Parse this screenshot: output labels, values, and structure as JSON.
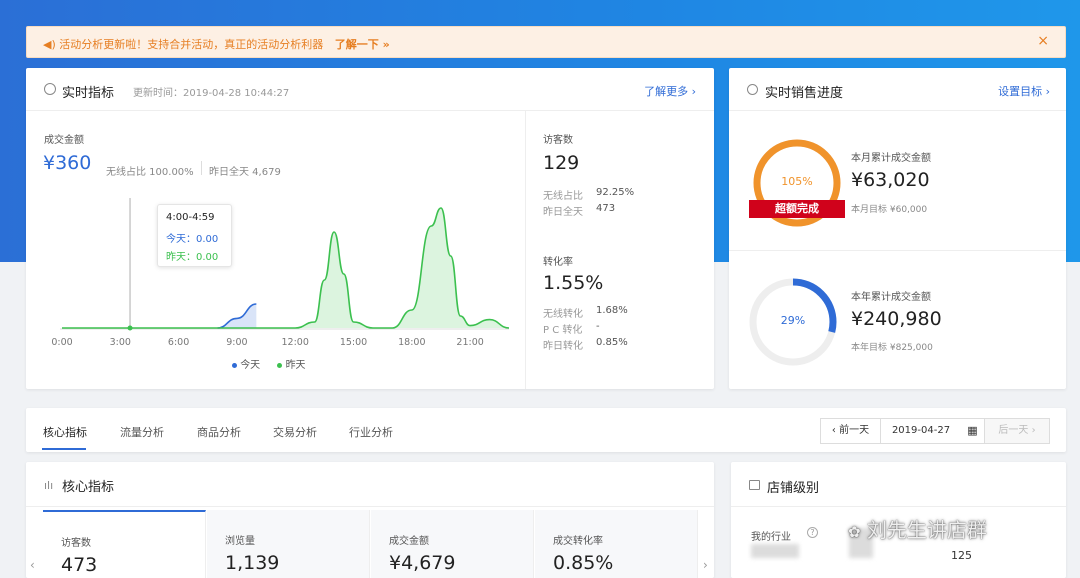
{
  "notice": {
    "text": "活动分析更新啦！支持合并活动，真正的活动分析利器",
    "more": "了解一下 »",
    "close": "×"
  },
  "realtime": {
    "title": "实时指标",
    "update_time": "更新时间：2019-04-28 10:44:27",
    "more": "了解更多 ›",
    "gmv_label": "成交金额",
    "gmv_value": "¥360",
    "wireless_ratio": "无线占比 100.00%",
    "yesterday_total": "昨日全天 4,679",
    "tooltip": {
      "time": "4:00-4:59",
      "today": "今天：0.00",
      "yesterday": "昨天：0.00"
    },
    "legend": {
      "today": "今天",
      "yesterday": "昨天"
    },
    "visitors": {
      "label": "访客数",
      "value": "129",
      "row1_label": "无线占比",
      "row1_value": "92.25%",
      "row2_label": "昨日全天",
      "row2_value": "473"
    },
    "conversion": {
      "label": "转化率",
      "value": "1.55%",
      "row1_label": "无线转化",
      "row1_value": "1.68%",
      "row2_label": "P C 转化",
      "row2_value": "-",
      "row3_label": "昨日转化",
      "row3_value": "0.85%"
    }
  },
  "chart_data": {
    "type": "area",
    "x_ticks": [
      "0:00",
      "3:00",
      "6:00",
      "9:00",
      "12:00",
      "15:00",
      "18:00",
      "21:00"
    ],
    "series": [
      {
        "name": "今天",
        "color": "#2f6bd6",
        "x": [
          8,
          9,
          10
        ],
        "values": [
          0,
          0.08,
          0.2
        ]
      },
      {
        "name": "昨天",
        "color": "#3cc04f",
        "x": [
          0,
          1,
          2,
          3,
          4,
          5,
          6,
          7,
          8,
          9,
          10,
          11,
          12,
          13,
          13.5,
          14,
          14.5,
          15,
          16,
          17,
          18,
          19,
          19.5,
          20,
          20.5,
          21,
          22,
          23
        ],
        "values": [
          0,
          0,
          0,
          0,
          0,
          0,
          0,
          0,
          0,
          0,
          0,
          0,
          0,
          0.05,
          0.4,
          0.8,
          0.45,
          0.05,
          0,
          0,
          0.15,
          0.85,
          1.0,
          0.6,
          0.1,
          0.02,
          0.07,
          0
        ]
      }
    ]
  },
  "sales_progress": {
    "title": "实时销售进度",
    "settings": "设置目标 ›",
    "month": {
      "percent_label": "105%",
      "percent": 1.05,
      "ribbon": "超额完成",
      "label": "本月累计成交金额",
      "value": "¥63,020",
      "target": "本月目标 ¥60,000"
    },
    "year": {
      "percent_label": "29%",
      "percent": 0.29,
      "label": "本年累计成交金额",
      "value": "¥240,980",
      "target": "本年目标 ¥825,000"
    }
  },
  "tabs": [
    "核心指标",
    "流量分析",
    "商品分析",
    "交易分析",
    "行业分析"
  ],
  "date_nav": {
    "prev": "‹ 前一天",
    "date": "2019-04-27",
    "next": "后一天 ›"
  },
  "core": {
    "title": "核心指标",
    "kpis": [
      {
        "label": "访客数",
        "value": "473"
      },
      {
        "label": "浏览量",
        "value": "1,139"
      },
      {
        "label": "成交金额",
        "value": "¥4,679"
      },
      {
        "label": "成交转化率",
        "value": "0.85%"
      }
    ]
  },
  "store_level": {
    "title": "店铺级别",
    "industry_label": "我的行业",
    "value": "125"
  },
  "watermark": "刘先生讲店群",
  "colors": {
    "accent": "#2f6bd6",
    "green": "#3cc04f",
    "orange": "#f0932b",
    "red": "#d0021b"
  }
}
